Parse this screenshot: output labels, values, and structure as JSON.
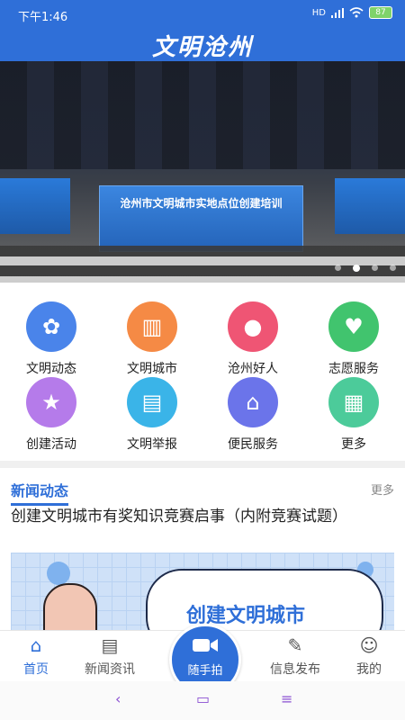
{
  "status_bar": {
    "time": "下午1:46",
    "network": "HD",
    "battery": "87"
  },
  "header": {
    "title": "文明沧州"
  },
  "banner": {
    "screen_text": "沧州市文明城市实地点位创建培训",
    "dots": 4,
    "active_dot": 1
  },
  "menu": [
    {
      "label": "文明动态",
      "icon": "flower-icon",
      "color": "#4a84ea"
    },
    {
      "label": "文明城市",
      "icon": "building-icon",
      "color": "#f58a45"
    },
    {
      "label": "沧州好人",
      "icon": "person-icon",
      "color": "#ef5574"
    },
    {
      "label": "志愿服务",
      "icon": "volunteer-icon",
      "color": "#41c46e"
    },
    {
      "label": "创建活动",
      "icon": "star-icon",
      "color": "#b57bea"
    },
    {
      "label": "文明举报",
      "icon": "report-icon",
      "color": "#3ab4e8"
    },
    {
      "label": "便民服务",
      "icon": "house-icon",
      "color": "#6b74ea"
    },
    {
      "label": "更多",
      "icon": "grid-icon",
      "color": "#4ccb9a"
    }
  ],
  "news": {
    "title": "新闻动态",
    "more": "更多",
    "headline": "创建文明城市有奖知识竞赛启事（内附竞赛试题）",
    "image_text": "创建文明城市"
  },
  "tabs": [
    {
      "label": "首页",
      "icon": "home-icon",
      "active": true
    },
    {
      "label": "新闻资讯",
      "icon": "newspaper-icon",
      "active": false
    },
    {
      "label": "信息发布",
      "icon": "edit-icon",
      "active": false
    },
    {
      "label": "我的",
      "icon": "user-icon",
      "active": false
    }
  ],
  "camera": {
    "label": "随手拍",
    "icon": "video-camera-icon"
  },
  "system_nav": {
    "back": "‹",
    "home": "▭",
    "menu": "≡"
  },
  "colors": {
    "primary": "#2f6fd8"
  }
}
